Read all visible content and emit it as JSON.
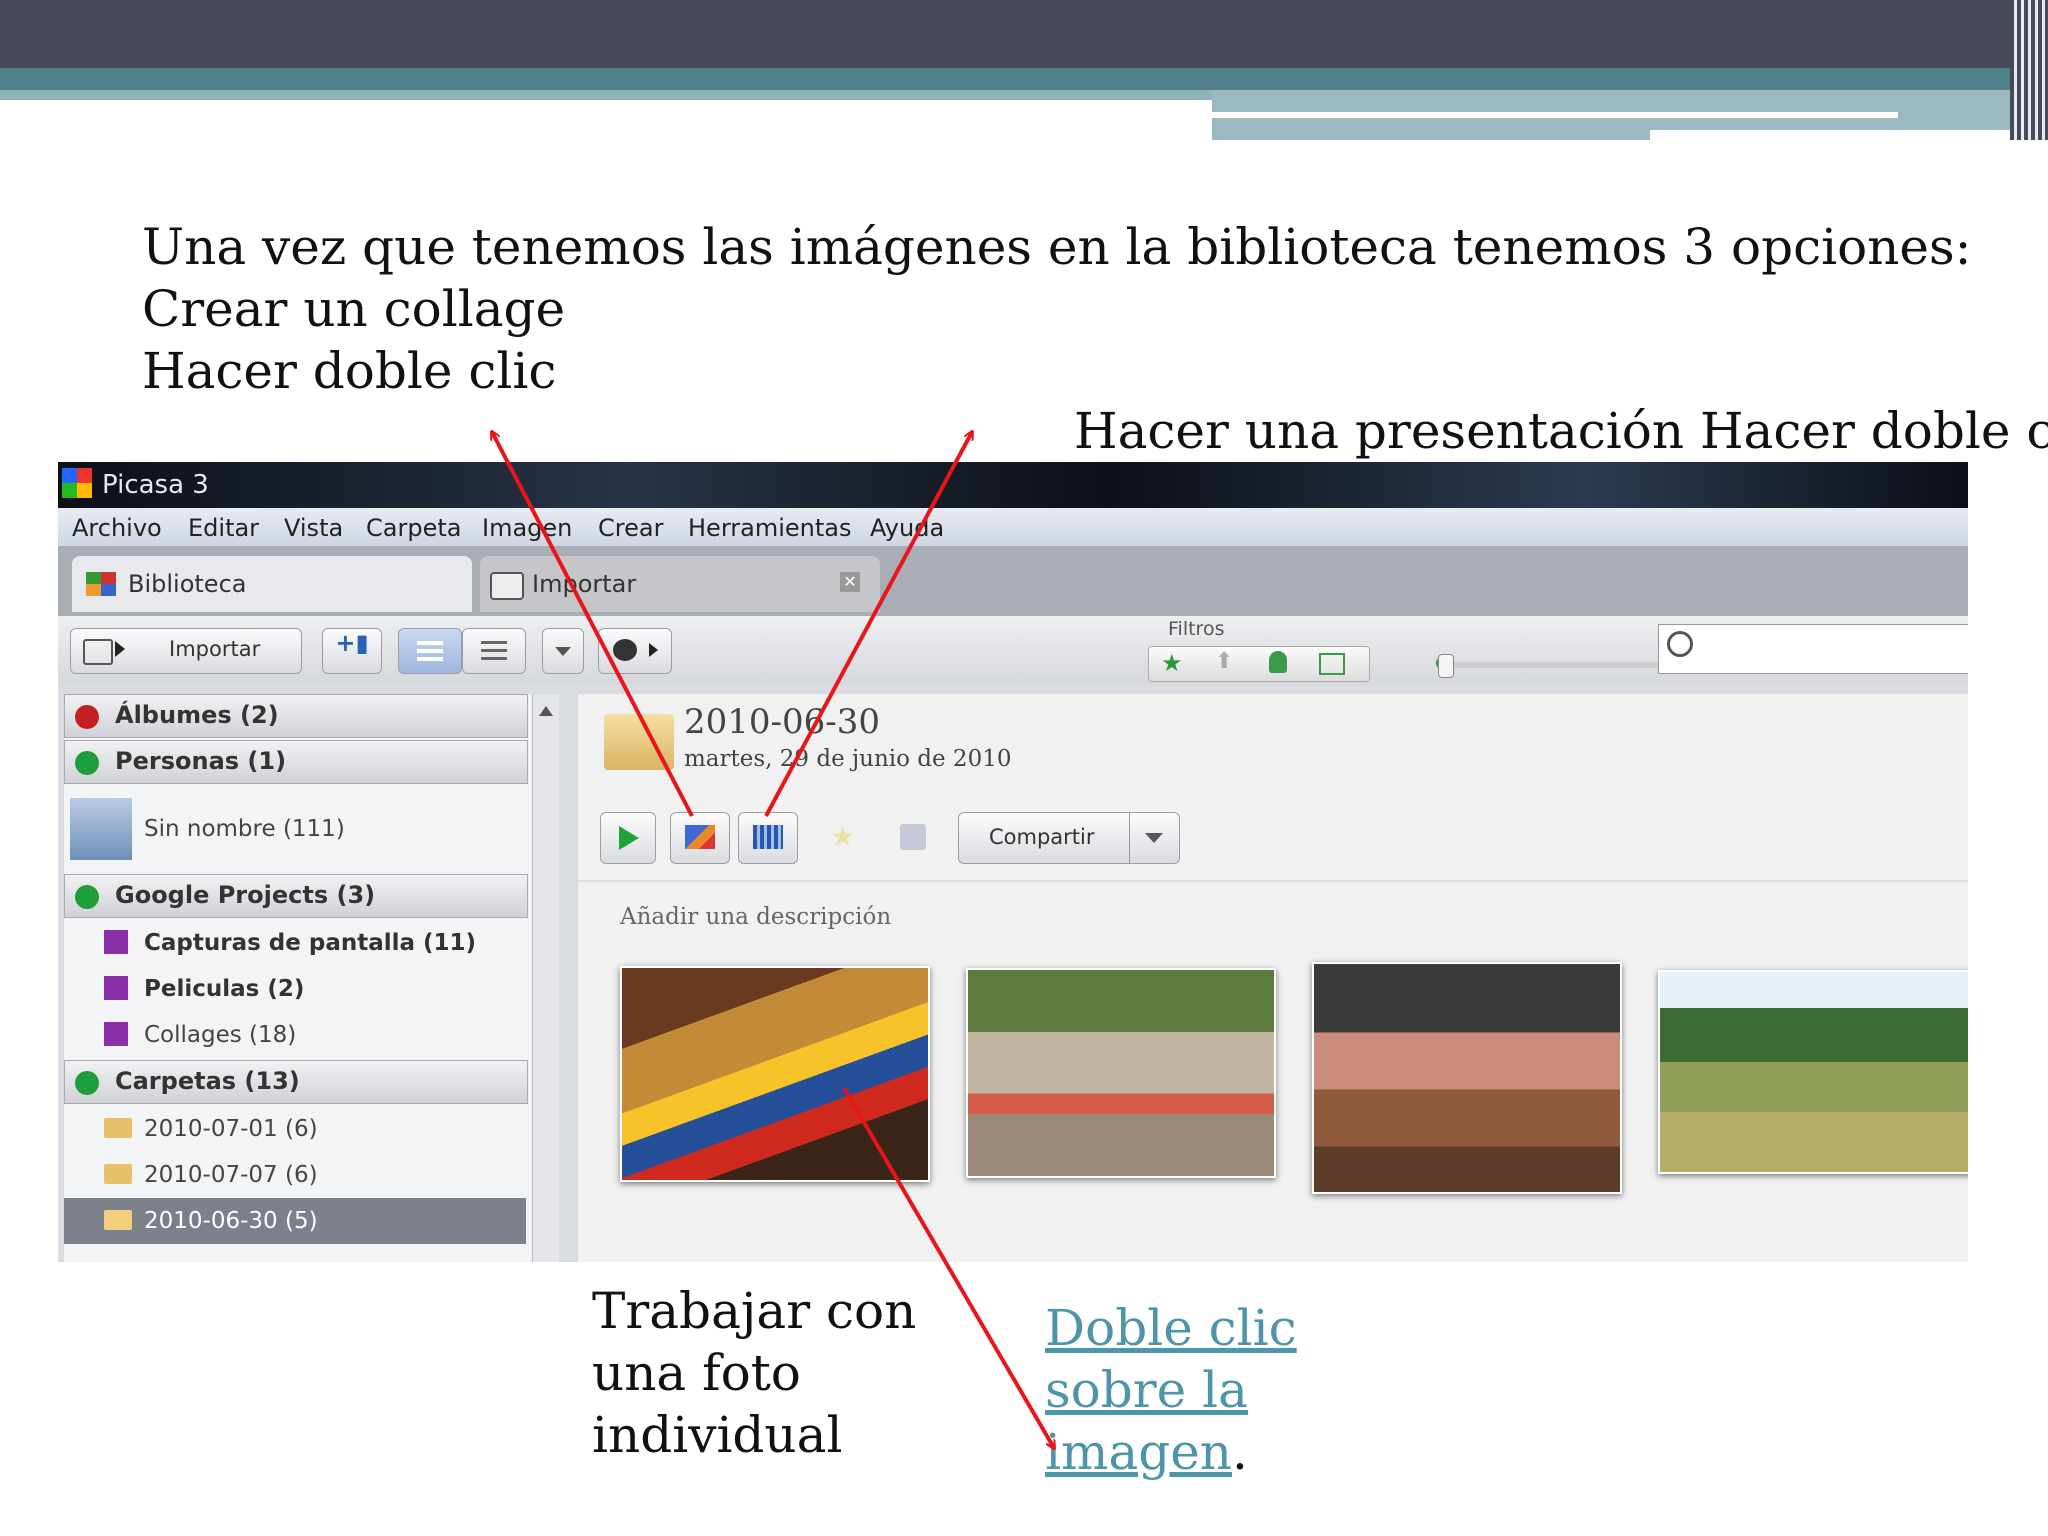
{
  "slide": {
    "heading_lines": [
      "Una vez que tenemos las imágenes en la biblioteca tenemos 3 opciones:",
      "Crear un collage",
      "Hacer doble clic"
    ],
    "presentation_text": "Hacer una presentación Hacer doble clic",
    "individual_lines": [
      "Trabajar con",
      "una foto",
      "individual"
    ],
    "link_lines": [
      "Doble clic",
      "sobre la",
      "imagen"
    ],
    "link_period": "."
  },
  "app": {
    "title": "Picasa 3",
    "menu": [
      "Archivo",
      "Editar",
      "Vista",
      "Carpeta",
      "Imagen",
      "Crear",
      "Herramientas",
      "Ayuda"
    ],
    "tabs": {
      "library": "Biblioteca",
      "import": "Importar"
    },
    "toolbar": {
      "import_label": "Importar",
      "filters_label": "Filtros"
    },
    "sidebar": {
      "albums": "Álbumes (2)",
      "people": "Personas (1)",
      "unnamed": "Sin nombre (111)",
      "google_projects": "Google Projects (3)",
      "project_items": [
        "Capturas de pantalla (11)",
        "Peliculas (2)",
        "Collages (18)"
      ],
      "folders": "Carpetas (13)",
      "folder_items": [
        "2010-07-01 (6)",
        "2010-07-07 (6)",
        "2010-06-30 (5)"
      ]
    },
    "main": {
      "folder_title": "2010-06-30",
      "folder_date": "martes, 29 de junio de 2010",
      "share_label": "Compartir",
      "description_placeholder": "Añadir una descripción"
    }
  },
  "colors": {
    "arrow": "#e8151b",
    "link": "#4d95a8",
    "header_dark": "#474a5b",
    "header_teal": "#4f7f8a"
  }
}
